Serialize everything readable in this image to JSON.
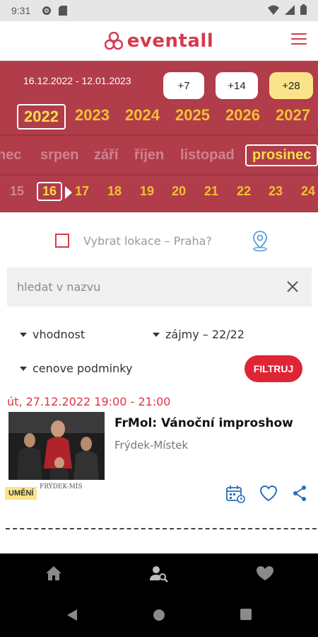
{
  "status_bar": {
    "time": "9:31"
  },
  "header": {
    "logo_text": "eventall",
    "menu_icon": "hamburger-menu-icon"
  },
  "date_range": {
    "text": "16.12.2022 - 12.01.2023",
    "chips": [
      "+7",
      "+14",
      "+28"
    ],
    "active_chip": "+28"
  },
  "years": [
    "2022",
    "2023",
    "2024",
    "2025",
    "2026",
    "2027"
  ],
  "selected_year": "2022",
  "months": [
    "nec",
    "srpen",
    "září",
    "říjen",
    "listopad",
    "prosinec"
  ],
  "selected_month": "prosinec",
  "days": [
    "15",
    "16",
    "17",
    "18",
    "19",
    "20",
    "21",
    "22",
    "23",
    "24"
  ],
  "selected_day": "16",
  "location": {
    "label": "Vybrat lokace – Praha?",
    "checked": false
  },
  "search": {
    "placeholder": "hledat v nazvu",
    "value": ""
  },
  "filters": {
    "suitability": "vhodnost",
    "interests": "zájmy – 22/22",
    "price": "cenove podminky",
    "apply_button": "FILTRUJ"
  },
  "event": {
    "datetime": "út, 27.12.2022 19:00 - 21:00",
    "title": "FrMol: Vánoční improshow",
    "place": "Frýdek-Místek",
    "category": "UMĚNÍ",
    "image_caption": "FRÝDEK-MÍS"
  },
  "colors": {
    "brand": "#d53a4d",
    "panel": "#b13c4a",
    "highlight": "#f1c232",
    "filter_button": "#df2434",
    "tag": "#fbe38a"
  },
  "bottom_nav": [
    "home-icon",
    "user-search-icon",
    "heart-icon"
  ]
}
